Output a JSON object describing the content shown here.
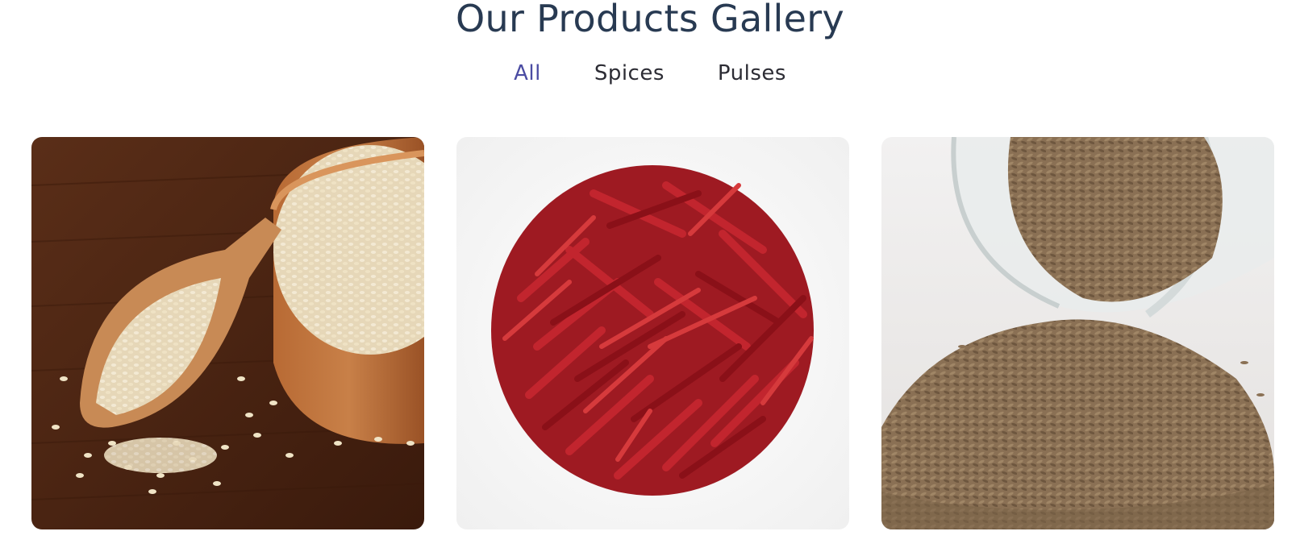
{
  "gallery": {
    "title": "Our Products Gallery",
    "filters": [
      {
        "label": "All",
        "active": true
      },
      {
        "label": "Spices",
        "active": false
      },
      {
        "label": "Pulses",
        "active": false
      }
    ],
    "items": [
      {
        "subject": "sesame-seeds-in-wooden-bowl-and-scoop"
      },
      {
        "subject": "dried-red-chillies-pile"
      },
      {
        "subject": "cumin-seeds-spilling-from-glass-jar"
      }
    ]
  },
  "colors": {
    "title": "#283a52",
    "active_filter": "#4b4ca3",
    "filter": "#2c2c34"
  }
}
